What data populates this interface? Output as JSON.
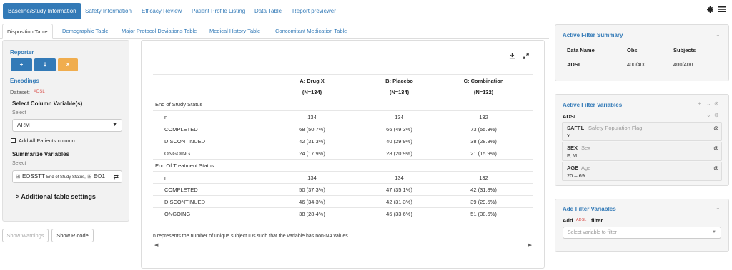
{
  "topnav": {
    "tabs": [
      "Baseline/Study Information",
      "Safety Information",
      "Efficacy Review",
      "Patient Profile Listing",
      "Data Table",
      "Report previewer"
    ],
    "gear_icon": "gear-icon",
    "menu_icon": "hamburger-menu-icon"
  },
  "subnav": {
    "tabs": [
      "Disposition Table",
      "Demographic Table",
      "Major Protocol Deviations Table",
      "Medical History Table",
      "Concomitant Medication Table"
    ]
  },
  "left": {
    "reporter_label": "Reporter",
    "add_btn": "+",
    "download_btn": "⤓",
    "reset_btn": "×",
    "encodings_label": "Encodings",
    "dataset_label": "Dataset:",
    "dataset_name": "ADSL",
    "col_var_label": "Select Column Variable(s)",
    "col_var_hint": "Select",
    "col_var_value": "ARM",
    "add_all_label": "Add All Patients column",
    "summarize_label": "Summarize Variables",
    "summarize_hint": "Select",
    "summarize_value_main": "EOSSTT",
    "summarize_value_sub": "End of Study Status,",
    "summarize_value_more": "EO1",
    "additional_label": "> Additional table settings"
  },
  "bottom": {
    "warnings_btn": "Show Warnings",
    "rcode_btn": "Show R code"
  },
  "table": {
    "headers": [
      "",
      "A: Drug X",
      "B: Placebo",
      "C: Combination"
    ],
    "ns": [
      "",
      "(N=134)",
      "(N=134)",
      "(N=132)"
    ],
    "rows": [
      {
        "label": "End of Study Status",
        "v": [
          "",
          "",
          ""
        ],
        "indent": false
      },
      {
        "label": "n",
        "v": [
          "134",
          "134",
          "132"
        ],
        "indent": true
      },
      {
        "label": "COMPLETED",
        "v": [
          "68 (50.7%)",
          "66 (49.3%)",
          "73 (55.3%)"
        ],
        "indent": true
      },
      {
        "label": "DISCONTINUED",
        "v": [
          "42 (31.3%)",
          "40 (29.9%)",
          "38 (28.8%)"
        ],
        "indent": true
      },
      {
        "label": "ONGOING",
        "v": [
          "24 (17.9%)",
          "28 (20.9%)",
          "21 (15.9%)"
        ],
        "indent": true
      },
      {
        "label": "End Of Treatment Status",
        "v": [
          "",
          "",
          ""
        ],
        "indent": false
      },
      {
        "label": "n",
        "v": [
          "134",
          "134",
          "132"
        ],
        "indent": true
      },
      {
        "label": "COMPLETED",
        "v": [
          "50 (37.3%)",
          "47 (35.1%)",
          "42 (31.8%)"
        ],
        "indent": true
      },
      {
        "label": "DISCONTINUED",
        "v": [
          "46 (34.3%)",
          "42 (31.3%)",
          "39 (29.5%)"
        ],
        "indent": true
      },
      {
        "label": "ONGOING",
        "v": [
          "38 (28.4%)",
          "45 (33.6%)",
          "51 (38.6%)"
        ],
        "indent": true
      }
    ],
    "footnote": "n represents the number of unique subject IDs such that the variable has non-NA values.",
    "download_icon": "download-icon",
    "expand_icon": "expand-icon"
  },
  "summary": {
    "title": "Active Filter Summary",
    "col_headers": [
      "Data Name",
      "Obs",
      "Subjects"
    ],
    "row": [
      "ADSL",
      "400/400",
      "400/400"
    ]
  },
  "active_vars": {
    "title": "Active Filter Variables",
    "dataset": "ADSL",
    "filters": [
      {
        "name": "SAFFL",
        "desc": "Safety Population Flag",
        "value": "Y"
      },
      {
        "name": "SEX",
        "desc": "Sex",
        "value": "F, M"
      },
      {
        "name": "AGE",
        "desc": "Age",
        "value": "20 – 69"
      }
    ]
  },
  "add_vars": {
    "title": "Add Filter Variables",
    "add_word": "Add",
    "dataset": "ADSL",
    "filter_word": "filter",
    "placeholder": "Select variable to filter"
  },
  "colors": {
    "accent": "#337ab7",
    "orange": "#f0ad4e",
    "badge_red": "#d9534f"
  }
}
